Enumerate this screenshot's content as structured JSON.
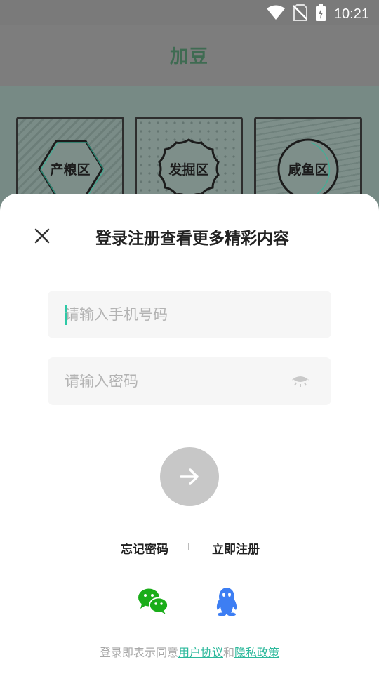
{
  "status_bar": {
    "time": "10:21",
    "icons": [
      "wifi-icon",
      "no-sim-icon",
      "battery-charging-icon"
    ]
  },
  "header": {
    "logo_text": "加豆"
  },
  "zones": [
    {
      "label": "产粮区",
      "badge_shape": "hexagon"
    },
    {
      "label": "发掘区",
      "badge_shape": "wavy-circle"
    },
    {
      "label": "咸鱼区",
      "badge_shape": "circle"
    }
  ],
  "login_sheet": {
    "title": "登录注册查看更多精彩内容",
    "close_icon": "close-icon",
    "phone_input": {
      "placeholder": "请输入手机号码",
      "value": ""
    },
    "password_input": {
      "placeholder": "请输入密码",
      "value": "",
      "toggle_icon": "eye-closed-icon"
    },
    "submit_icon": "arrow-right-icon",
    "forgot_password": "忘记密码",
    "register": "立即注册",
    "social": [
      "wechat-icon",
      "qq-icon"
    ],
    "agreement": {
      "prefix": "登录即表示同意",
      "user_agreement": "用户协议",
      "joiner": "和",
      "privacy_policy": "隐私政策"
    }
  },
  "colors": {
    "accent": "#2dc9a6",
    "link": "#2bb89b",
    "submit_disabled": "#c7c7c7",
    "input_bg": "#f6f6f6",
    "wechat": "#1aad19",
    "qq": "#3d7ef3",
    "overlay": "#7d7d7d"
  }
}
